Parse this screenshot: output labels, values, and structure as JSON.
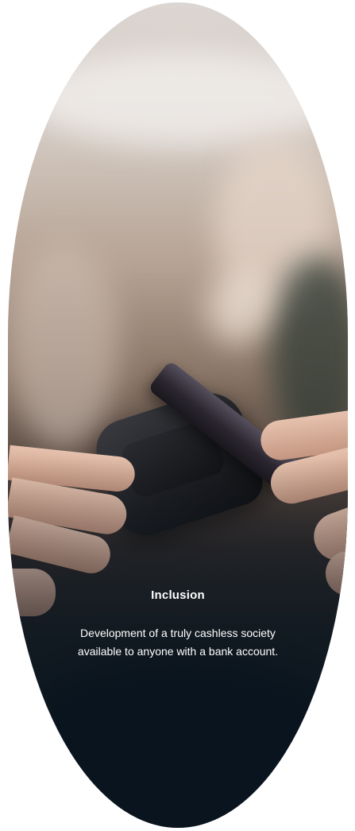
{
  "card": {
    "title": "Inclusion",
    "description": "Development of a truly cashless society available to anyone with a bank account."
  },
  "image": {
    "subject": "hands-tapping-phone-on-payment-terminal"
  },
  "colors": {
    "caption_text": "#ffffff",
    "overlay_dark": "#0f1a24"
  }
}
